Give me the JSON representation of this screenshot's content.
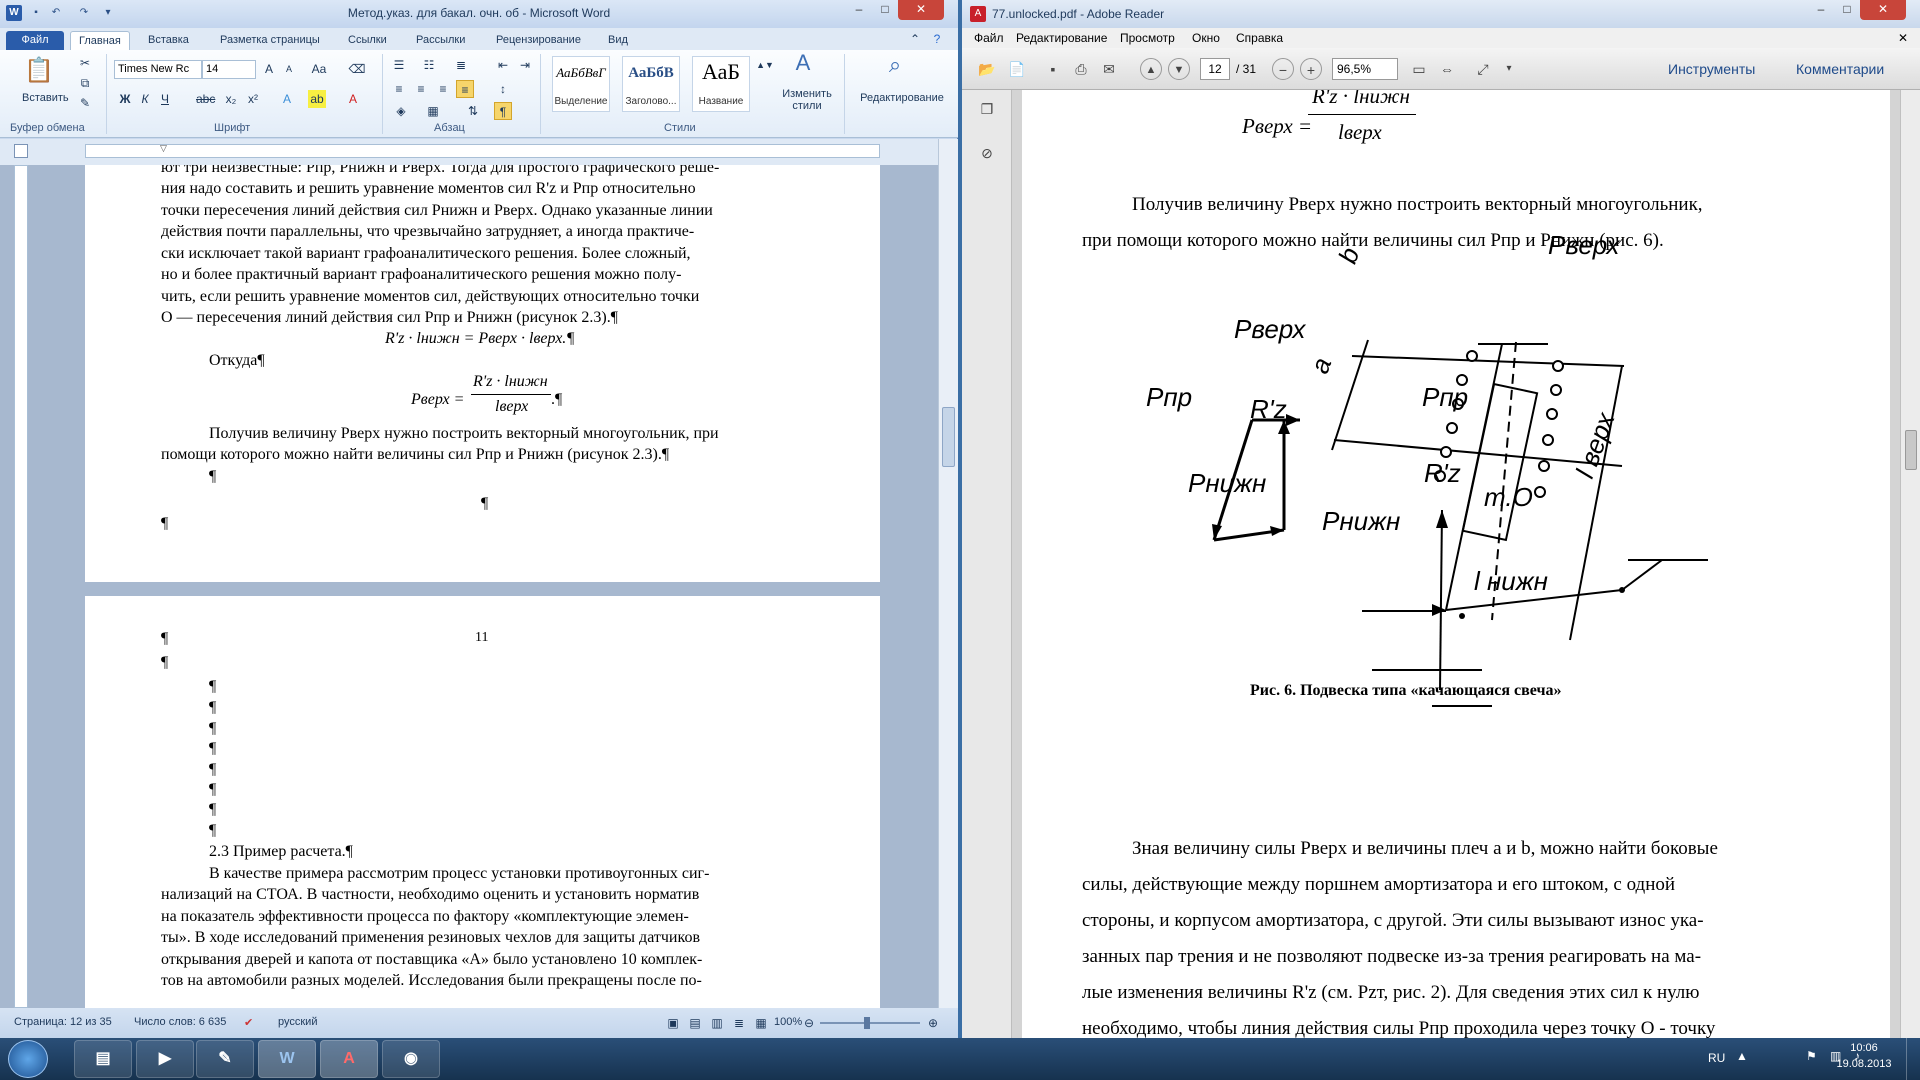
{
  "word": {
    "title": "Метод.указ. для бакал. очн. об - Microsoft Word",
    "tabs": [
      "Файл",
      "Главная",
      "Вставка",
      "Разметка страницы",
      "Ссылки",
      "Рассылки",
      "Рецензирование",
      "Вид"
    ],
    "clipboard": {
      "paste_label": "Вставить",
      "group_label": "Буфер обмена"
    },
    "font": {
      "name": "Times New Rc",
      "size": "14",
      "group_label": "Шрифт"
    },
    "paragraph": {
      "group_label": "Абзац"
    },
    "styles": {
      "group_label": "Стили",
      "items": [
        {
          "sample": "АаБбВвГ",
          "name": "Выделение"
        },
        {
          "sample": "АаБбВ",
          "name": "Заголово..."
        },
        {
          "sample": "АаБ",
          "name": "Название"
        }
      ],
      "change_label": "Изменить стили"
    },
    "editing_label": "Редактирование",
    "page1_lines": [
      "ют три неизвестные: Pпр, Pнижн и Pверх. Тогда для простого графического реше-",
      "ния надо составить и решить уравнение моментов сил R'z и Pпр относительно",
      "точки пересечения линий действия сил Pнижн и Pверх. Однако указанные линии",
      "действия почти параллельны, что чрезвычайно затрудняет, а иногда практиче-",
      "ски исключает такой вариант графоаналитического решения. Более сложный,",
      "но и более практичный вариант графоаналитического решения можно полу-",
      "чить, если решить уравнение моментов сил, действующих относительно точки",
      "О — пересечения линий действия сил Pпр и Pнижн (рисунок 2.3).¶"
    ],
    "eq1": "R'z · lнижн = Pверх · lверх.¶",
    "otkuda": "Откуда¶",
    "eq2_lhs": "Pверх =",
    "eq2_num": "R'z · lнижн",
    "eq2_den": "lверх",
    "eq2_tail": ".¶",
    "para_after_1": "Получив величину Pверх нужно построить векторный многоугольник, при",
    "para_after_2": "помощи которого можно найти величины сил Pпр и Pнижн (рисунок 2.3).¶",
    "pilcrow": "¶",
    "page_number": "11",
    "section_title": "2.3 Пример расчета.¶",
    "page2_lines": [
      "В качестве примера рассмотрим процесс установки противоугонных сиг-",
      "нализаций на СТОА. В частности, необходимо оценить и установить норматив",
      "на показатель эффективности процесса по фактору «комплектующие элемен-",
      "ты». В ходе исследований применения резиновых чехлов для защиты датчиков",
      "открывания дверей и капота от поставщика «А» было установлено 10 комплек-",
      "тов на автомобили разных моделей. Исследования были прекращены после по-"
    ],
    "status": {
      "page": "Страница: 12 из 35",
      "words": "Число слов: 6 635",
      "lang": "русский",
      "zoom": "100%"
    }
  },
  "pdf": {
    "title": "77.unlocked.pdf - Adobe Reader",
    "menu": [
      "Файл",
      "Редактирование",
      "Просмотр",
      "Окно",
      "Справка"
    ],
    "page_current": "12",
    "page_total": "/ 31",
    "zoom": "96,5%",
    "tools_label": "Инструменты",
    "comments_label": "Комментарии",
    "formula_lhs": "Pверх =",
    "formula_num": "R'z · lнижн",
    "formula_den": "lверх",
    "para1_line1": "Получив величину Pверх нужно построить векторный многоугольник,",
    "para1_line2": "при помощи которого можно найти величины сил Pпр и Pнижн (рис. 6).",
    "diagram_labels": {
      "p_verh_left": "Pверх",
      "p_pr_left": "Pпр",
      "r_z_left": "R'z",
      "p_nizh_left": "Pнижн",
      "a": "a",
      "b": "b",
      "p_verh_right": "Pверх",
      "p_pr_right": "Pпр",
      "r_z_right": "R'z",
      "t_o": "т.О",
      "l_verh": "l верх",
      "p_nizh_right": "Pнижн",
      "l_nizh": "l нижн"
    },
    "caption": "Рис. 6. Подвеска типа «качающаяся свеча»",
    "para2_lines": [
      "Зная величину силы Pверх и величины плеч a и b, можно найти боковые",
      "силы, действующие между поршнем амортизатора и его штоком, с одной",
      "стороны, и корпусом амортизатора, с другой. Эти силы вызывают износ ука-",
      "занных пар трения и не позволяют подвеске из-за трения реагировать на ма-",
      "лые изменения величины R'z (см. Pzт, рис. 2). Для сведения этих сил к нулю",
      "необходимо, чтобы линия действия силы Pпр проходила через точку О - точку"
    ]
  },
  "taskbar": {
    "lang": "RU",
    "time": "10:06",
    "date": "19.08.2013"
  }
}
